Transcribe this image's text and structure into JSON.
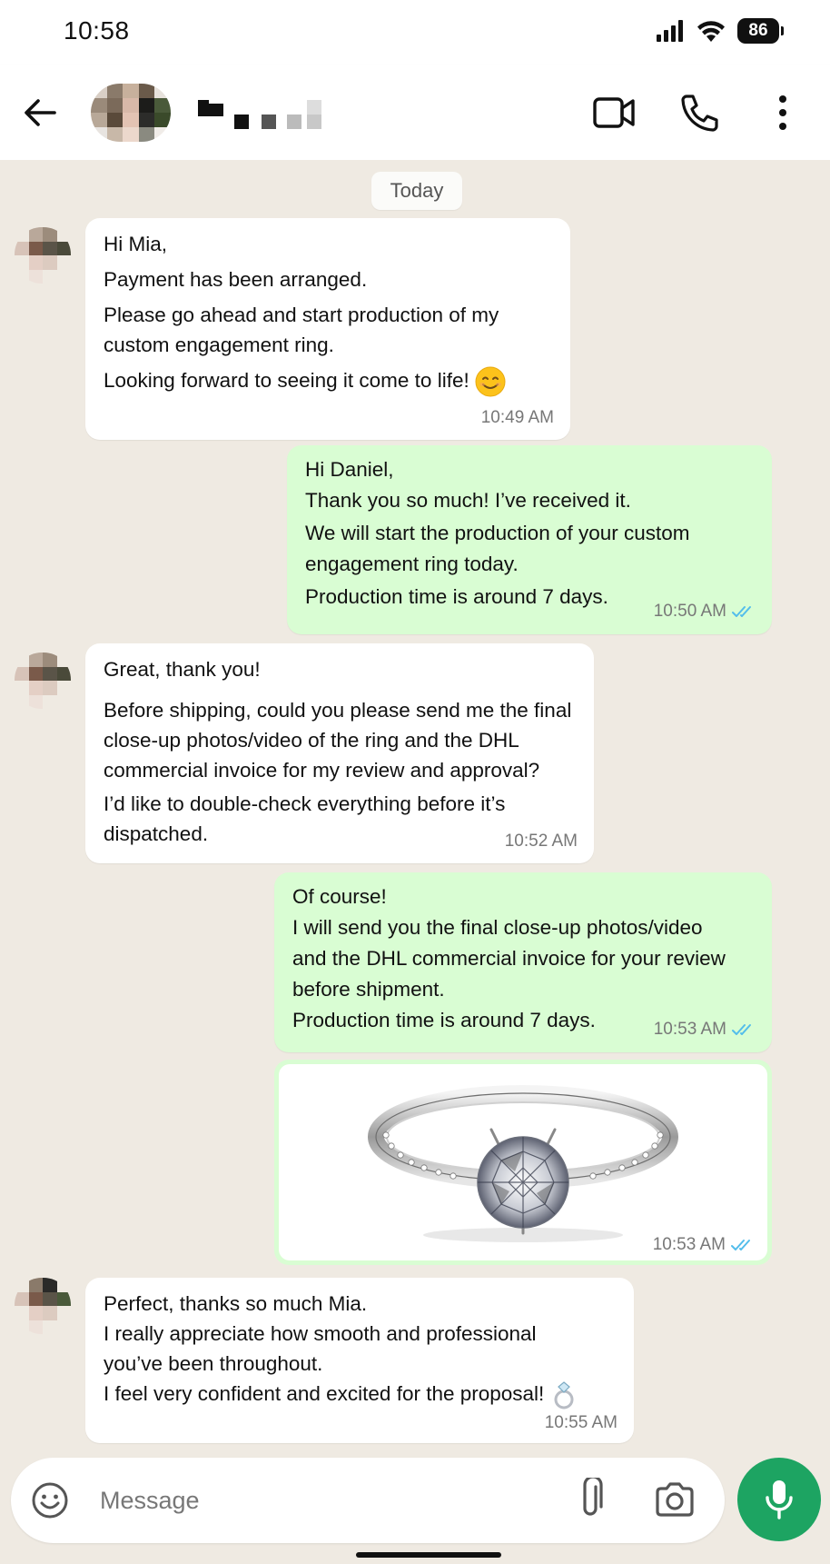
{
  "status_bar": {
    "time": "10:58",
    "battery": "86"
  },
  "header": {
    "contact_name": "",
    "icons": [
      "back-arrow-icon",
      "video-call-icon",
      "voice-call-icon",
      "more-options-icon"
    ]
  },
  "chat": {
    "date_label": "Today",
    "messages": [
      {
        "direction": "incoming",
        "lines": [
          "Hi Mia,",
          "Payment has been arranged.",
          "Please go ahead and start production of my",
          "custom engagement ring.",
          "Looking forward to seeing it come to life!"
        ],
        "time": "10:49 AM"
      },
      {
        "direction": "outgoing",
        "lines": [
          "Hi Daniel,",
          "Thank you so much! I’ve received it.",
          "We will start the production of your custom",
          "engagement ring today.",
          "Production time is around 7 days."
        ],
        "time": "10:50 AM"
      },
      {
        "direction": "incoming",
        "lines": [
          "Great, thank you!",
          "Before shipping, could you please send me the final",
          "close-up photos/video of the ring and the DHL",
          "commercial invoice for my review and approval?",
          "I’d like to double-check everything before it’s",
          "dispatched."
        ],
        "time": "10:52 AM"
      },
      {
        "direction": "outgoing",
        "lines": [
          "Of course!",
          "I will send you the final close-up photos/video",
          "and the DHL commercial invoice for your review",
          "before shipment.",
          "Production time is around 7 days."
        ],
        "time": "10:53 AM"
      },
      {
        "direction": "outgoing",
        "type": "image",
        "image": "engagement-ring-photo",
        "time": "10:53 AM"
      },
      {
        "direction": "incoming",
        "lines": [
          "Perfect, thanks so much Mia.",
          "I really appreciate how smooth and professional",
          "you’ve been throughout.",
          "I feel very confident and excited for the proposal!"
        ],
        "time": "10:55 AM"
      }
    ]
  },
  "input": {
    "placeholder": "Message"
  },
  "colors": {
    "chat_background": "#efeae2",
    "outgoing_bubble": "#d9fdd3",
    "incoming_bubble": "#ffffff",
    "read_tick": "#53bdeb",
    "mic_button": "#1da462"
  }
}
